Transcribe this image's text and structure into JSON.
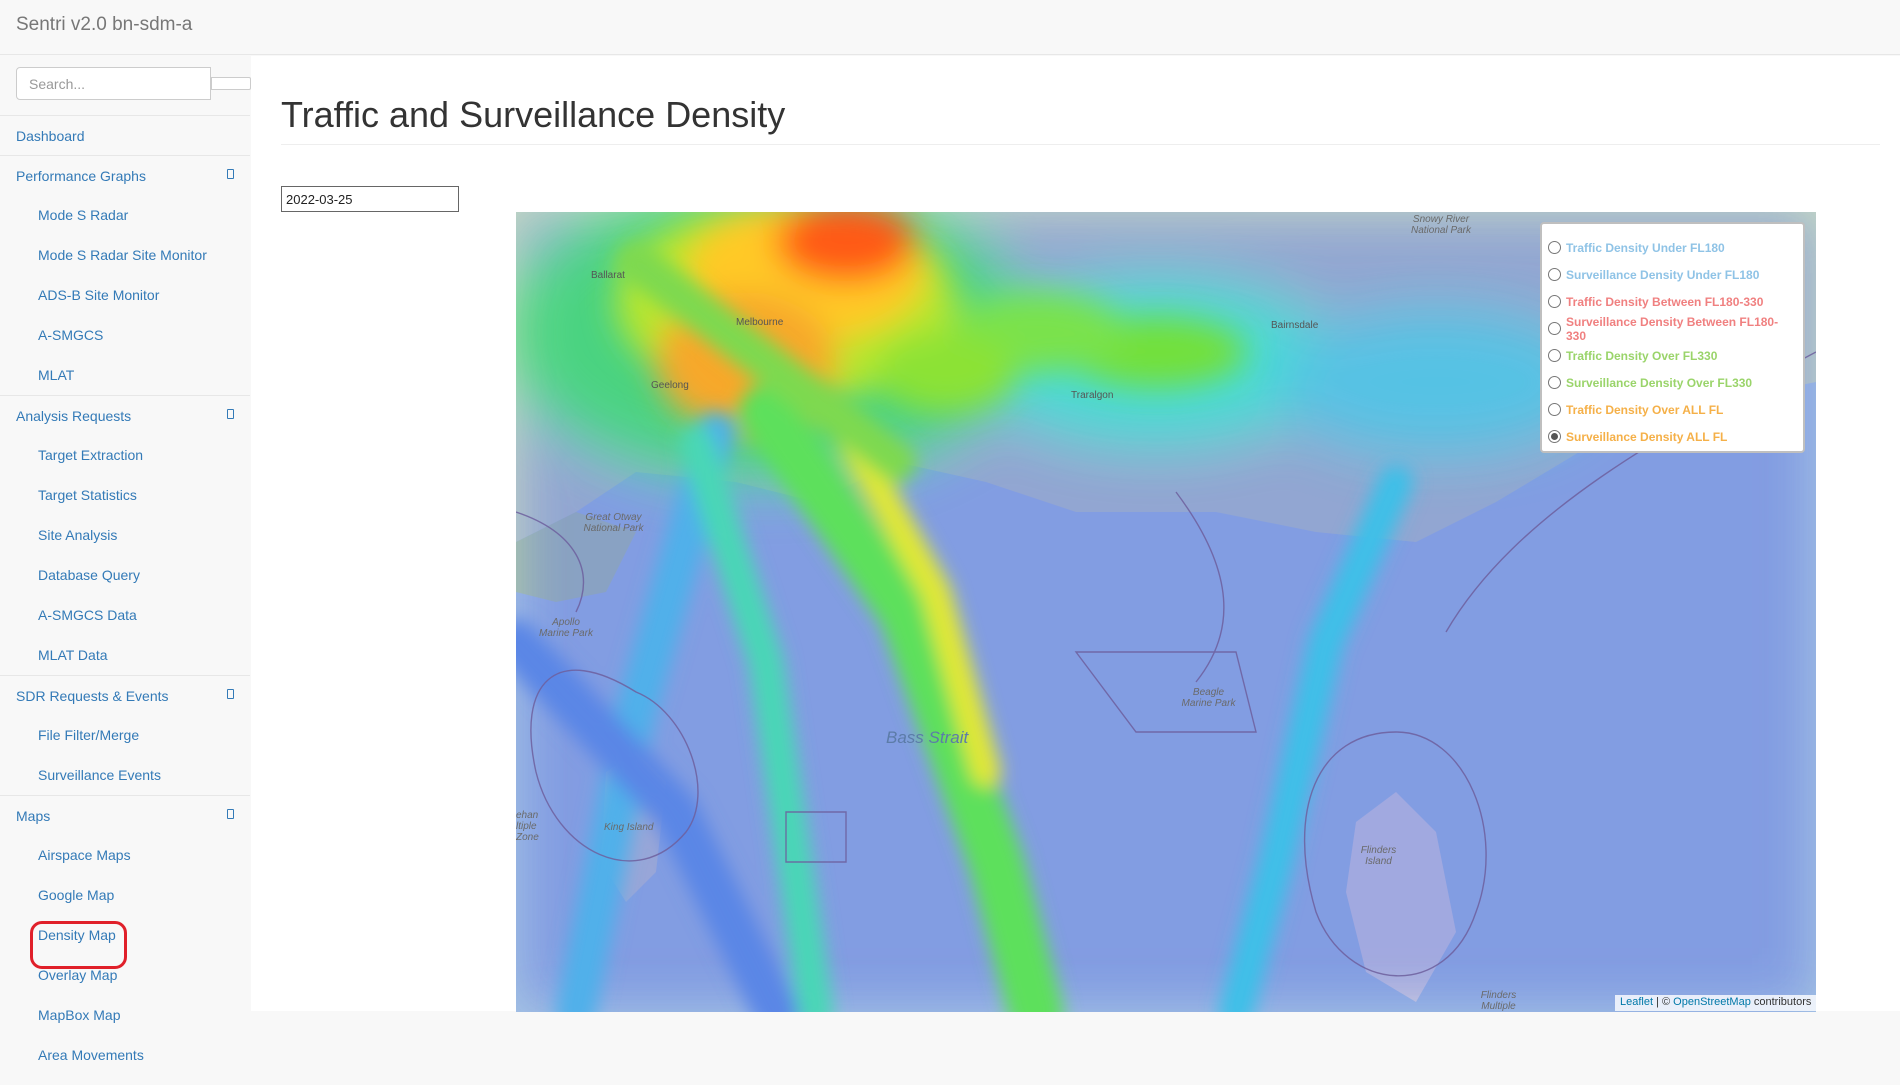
{
  "app": {
    "title": "Sentri v2.0 bn-sdm-a"
  },
  "search": {
    "placeholder": "Search..."
  },
  "nav": {
    "dashboard": "Dashboard",
    "performance_graphs": "Performance Graphs",
    "mode_s_radar": "Mode S Radar",
    "mode_s_radar_site_monitor": "Mode S Radar Site Monitor",
    "adsb_site_monitor": "ADS-B Site Monitor",
    "asmgcs": "A-SMGCS",
    "mlat": "MLAT",
    "analysis_requests": "Analysis Requests",
    "target_extraction": "Target Extraction",
    "target_statistics": "Target Statistics",
    "site_analysis": "Site Analysis",
    "database_query": "Database Query",
    "asmgcs_data": "A-SMGCS Data",
    "mlat_data": "MLAT Data",
    "sdr_requests_events": "SDR Requests & Events",
    "file_filter_merge": "File Filter/Merge",
    "surveillance_events": "Surveillance Events",
    "maps": "Maps",
    "airspace_maps": "Airspace Maps",
    "google_map": "Google Map",
    "density_map": "Density Map",
    "overlay_map": "Overlay Map",
    "mapbox_map": "MapBox Map",
    "area_movements": "Area Movements"
  },
  "page": {
    "title": "Traffic and Surveillance Density",
    "date_value": "2022-03-25"
  },
  "legend": {
    "layers": [
      {
        "label": "Traffic Density Under FL180",
        "color": "#8fc3e6",
        "checked": false
      },
      {
        "label": "Surveillance Density Under FL180",
        "color": "#8fc3e6",
        "checked": false
      },
      {
        "label": "Traffic Density Between FL180-330",
        "color": "#f08080",
        "checked": false
      },
      {
        "label": "Surveillance Density Between FL180-330",
        "color": "#f08080",
        "checked": false
      },
      {
        "label": "Traffic Density Over FL330",
        "color": "#9ad46a",
        "checked": false
      },
      {
        "label": "Surveillance Density Over FL330",
        "color": "#9ad46a",
        "checked": false
      },
      {
        "label": "Traffic Density Over ALL FL",
        "color": "#f5b048",
        "checked": false
      },
      {
        "label": "Surveillance Density ALL FL",
        "color": "#f5b048",
        "checked": true
      }
    ]
  },
  "attribution": {
    "leaflet": "Leaflet",
    "sep": " | © ",
    "osm": "OpenStreetMap",
    "suffix": " contributors"
  },
  "map_labels": {
    "melbourne": "Melbourne",
    "geelong": "Geelong",
    "ballarat": "Ballarat",
    "traralgon": "Traralgon",
    "bairnsdale": "Bairnsdale",
    "great_otway": "Great Otway National Park",
    "apollo": "Apollo Marine Park",
    "bass_strait": "Bass Strait",
    "beagle": "Beagle Marine Park",
    "king_island": "King Island",
    "flinders_island": "Flinders Island",
    "snowy_river": "Snowy River National Park",
    "zeehan": "ehan ltiple Zone",
    "flinders_multiple": "Flinders Multiple"
  }
}
